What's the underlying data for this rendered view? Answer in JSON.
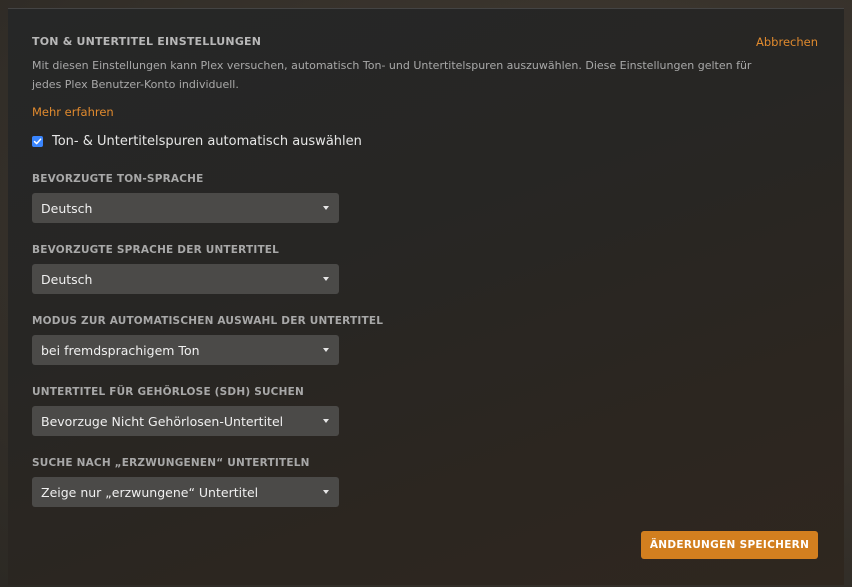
{
  "dialog": {
    "title": "TON & UNTERTITEL EINSTELLUNGEN",
    "cancel_label": "Abbrechen",
    "description": "Mit diesen Einstellungen kann Plex versuchen, automatisch Ton- und Untertitelspuren auszuwählen. Diese Einstellungen gelten für jedes Plex Benutzer-Konto individuell.",
    "learn_more_label": "Mehr erfahren",
    "auto_select": {
      "label": "Ton- & Untertitelspuren automatisch auswählen",
      "checked": true
    },
    "fields": [
      {
        "label": "BEVORZUGTE TON-SPRACHE",
        "value": "Deutsch"
      },
      {
        "label": "BEVORZUGTE SPRACHE DER UNTERTITEL",
        "value": "Deutsch"
      },
      {
        "label": "MODUS ZUR AUTOMATISCHEN AUSWAHL DER UNTERTITEL",
        "value": "bei fremdsprachigem Ton"
      },
      {
        "label": "UNTERTITEL FÜR GEHÖRLOSE (SDH) SUCHEN",
        "value": "Bevorzuge Nicht Gehörlosen-Untertitel"
      },
      {
        "label": "SUCHE NACH „ERZWUNGENEN“ UNTERTITELN",
        "value": "Zeige nur „erzwungene“ Untertitel"
      }
    ],
    "save_label": "ÄNDERUNGEN SPEICHERN"
  },
  "colors": {
    "accent": "#e08a2e",
    "button": "#d27f1f",
    "checkbox": "#3a86ff",
    "select_bg": "#4b4a48"
  },
  "icons": {
    "checkbox": "checkmark-icon",
    "select_caret": "caret-down-icon"
  }
}
